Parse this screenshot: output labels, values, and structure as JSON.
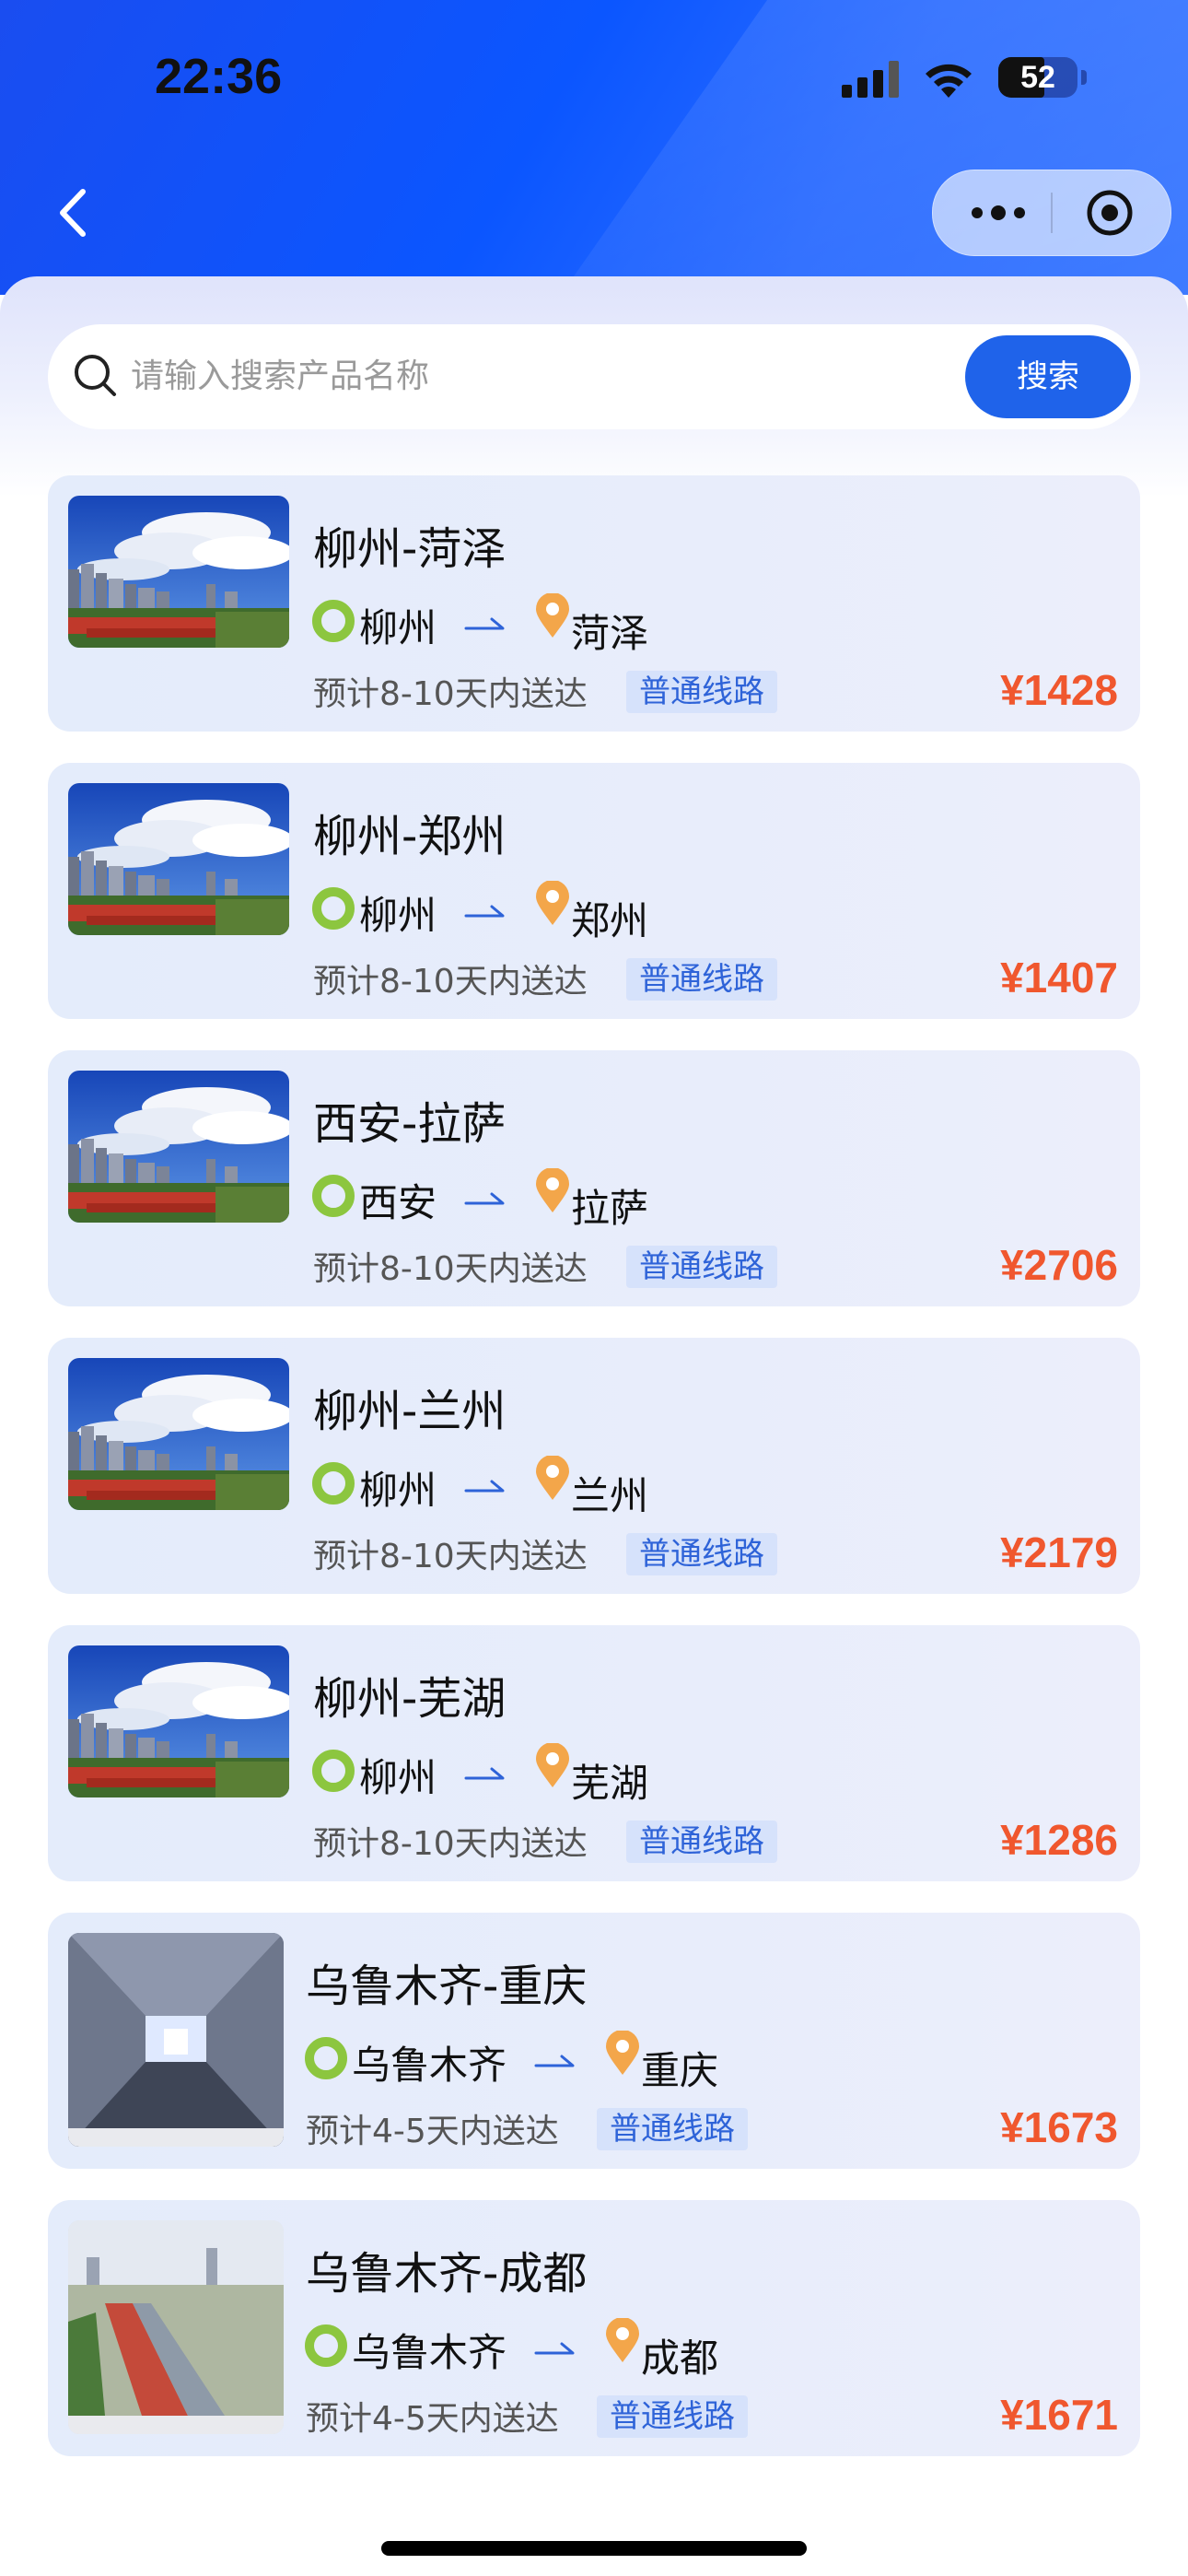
{
  "status_bar": {
    "time": "22:36",
    "battery": "52"
  },
  "search": {
    "placeholder": "请输入搜索产品名称",
    "button_label": "搜索"
  },
  "products": [
    {
      "title": "柳州-菏泽",
      "from": "柳州",
      "to": "菏泽",
      "eta": "预计8-10天内送达",
      "tag": "普通线路",
      "price": "¥1428",
      "image": "city-skyline"
    },
    {
      "title": "柳州-郑州",
      "from": "柳州",
      "to": "郑州",
      "eta": "预计8-10天内送达",
      "tag": "普通线路",
      "price": "¥1407",
      "image": "city-skyline"
    },
    {
      "title": "西安-拉萨",
      "from": "西安",
      "to": "拉萨",
      "eta": "预计8-10天内送达",
      "tag": "普通线路",
      "price": "¥2706",
      "image": "city-skyline"
    },
    {
      "title": "柳州-兰州",
      "from": "柳州",
      "to": "兰州",
      "eta": "预计8-10天内送达",
      "tag": "普通线路",
      "price": "¥2179",
      "image": "city-skyline"
    },
    {
      "title": "柳州-芜湖",
      "from": "柳州",
      "to": "芜湖",
      "eta": "预计8-10天内送达",
      "tag": "普通线路",
      "price": "¥1286",
      "image": "city-skyline"
    },
    {
      "title": "乌鲁木齐-重庆",
      "from": "乌鲁木齐",
      "to": "重庆",
      "eta": "预计4-5天内送达",
      "tag": "普通线路",
      "price": "¥1673",
      "image": "train-corridor"
    },
    {
      "title": "乌鲁木齐-成都",
      "from": "乌鲁木齐",
      "to": "成都",
      "eta": "预计4-5天内送达",
      "tag": "普通线路",
      "price": "¥1671",
      "image": "rail-yard"
    }
  ],
  "colors": {
    "brand_blue": "#1f63ea",
    "price_orange": "#f0572e",
    "origin_green": "#8cc63f",
    "dest_orange": "#f3a64a"
  }
}
